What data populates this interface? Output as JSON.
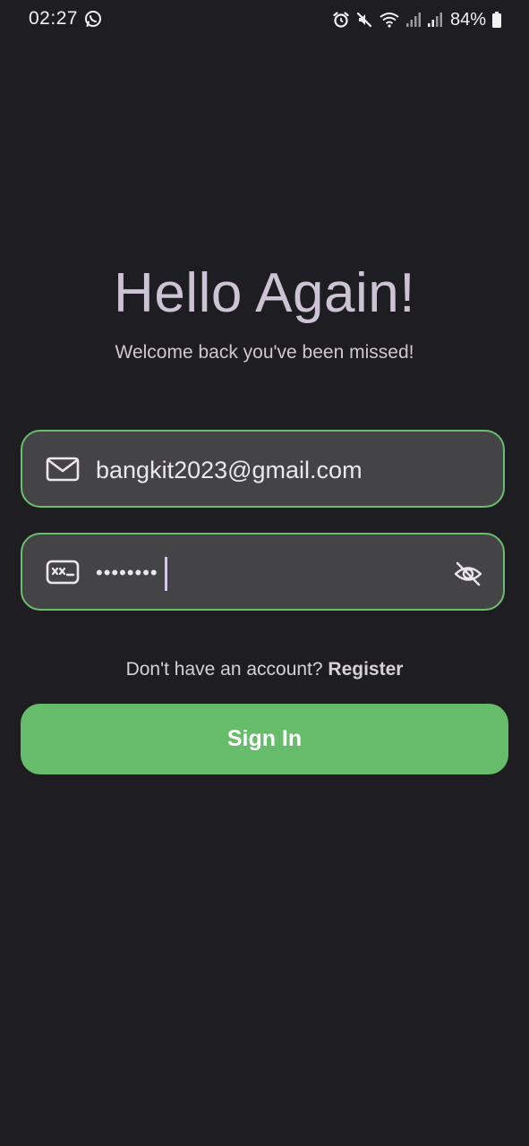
{
  "status_bar": {
    "time": "02:27",
    "battery_percent": "84%",
    "left_icons": [
      "whatsapp-icon"
    ],
    "right_icons": [
      "alarm-icon",
      "mute-icon",
      "wifi-icon",
      "signal-icon",
      "signal-icon",
      "battery-icon"
    ]
  },
  "header": {
    "title": "Hello Again!",
    "subtitle": "Welcome back you've been missed!"
  },
  "form": {
    "email": {
      "icon": "mail-icon",
      "value": "bangkit2023@gmail.com"
    },
    "password": {
      "icon": "password-icon",
      "masked_value": "••••••••",
      "visibility_icon": "eye-off-icon"
    }
  },
  "register": {
    "prompt": "Don't have an account? ",
    "link": "Register"
  },
  "sign_in": {
    "label": "Sign In"
  },
  "colors": {
    "background": "#1e1d22",
    "field_background": "#444447",
    "accent_green": "#67bc6c",
    "title_text": "#cdc3d4"
  }
}
